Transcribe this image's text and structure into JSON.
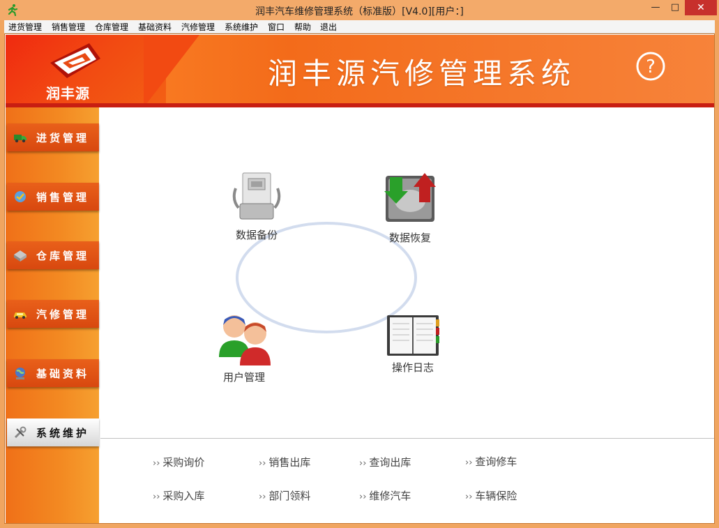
{
  "window": {
    "title": "润丰汽车维修管理系统（标准版）[V4.0][用户：]",
    "minimize_glyph": "—",
    "maximize_glyph": "□",
    "close_glyph": "✕"
  },
  "menu": [
    "进货管理",
    "销售管理",
    "仓库管理",
    "基础资料",
    "汽修管理",
    "系统维护",
    "窗口",
    "帮助",
    "退出"
  ],
  "banner": {
    "logo_text": "润丰源",
    "title": "润丰源汽修管理系统",
    "help_icon": "help-question-icon"
  },
  "sidebar": [
    {
      "label": "进货管理",
      "icon": "truck-icon",
      "active": false
    },
    {
      "label": "销售管理",
      "icon": "sales-icon",
      "active": false
    },
    {
      "label": "仓库管理",
      "icon": "warehouse-icon",
      "active": false
    },
    {
      "label": "汽修管理",
      "icon": "car-icon",
      "active": false
    },
    {
      "label": "基础资料",
      "icon": "globe-icon",
      "active": false
    },
    {
      "label": "系统维护",
      "icon": "wrench-icon",
      "active": true
    }
  ],
  "tiles": [
    {
      "label": "数据备份",
      "icon": "backup-icon"
    },
    {
      "label": "数据恢复",
      "icon": "restore-icon"
    },
    {
      "label": "用户管理",
      "icon": "users-icon"
    },
    {
      "label": "操作日志",
      "icon": "log-book-icon"
    }
  ],
  "quick_links": {
    "arrow": "››",
    "row1": [
      "采购询价",
      "销售出库",
      "查询出库",
      "查询修车"
    ],
    "row2": [
      "采购入库",
      "部门领料",
      "维修汽车",
      "车辆保险"
    ]
  },
  "colors": {
    "accent": "#f36b1a",
    "sidebar_active": "#e0e0e0",
    "close_button": "#c7302c"
  }
}
